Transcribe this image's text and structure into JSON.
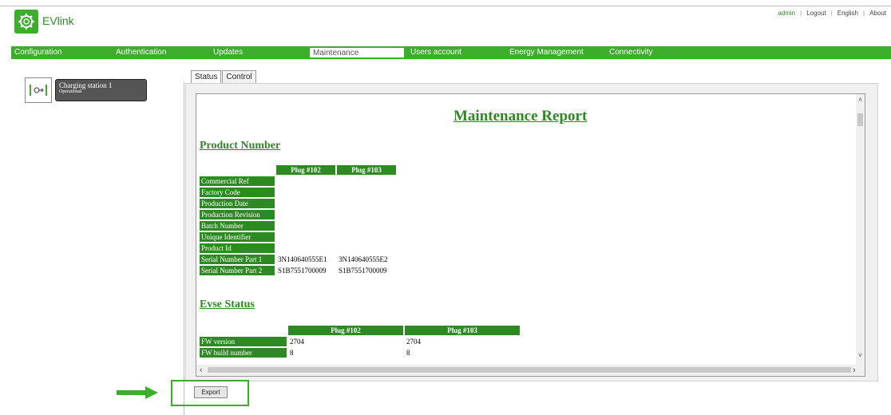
{
  "app": {
    "brand": "EVlink"
  },
  "toplinks": {
    "admin": "admin",
    "logout": "Logout",
    "language": "English",
    "about": "About",
    "separator": "|"
  },
  "nav": {
    "tabs": [
      {
        "label": "Configuration"
      },
      {
        "label": "Authentication"
      },
      {
        "label": "Updates"
      },
      {
        "label": "Maintenance",
        "active": true
      },
      {
        "label": "Users account"
      },
      {
        "label": "Energy Management"
      },
      {
        "label": "Connectivity"
      }
    ]
  },
  "station": {
    "name": "Charging station 1",
    "status": "Operational"
  },
  "subtabs": {
    "status": "Status",
    "control": "Control",
    "active": "Status"
  },
  "report": {
    "title": "Maintenance Report",
    "product_section": {
      "title": "Product Number",
      "headers": [
        "Plug #102",
        "Plug #103"
      ],
      "rows": [
        {
          "label": "Commercial Ref",
          "v1": "",
          "v2": ""
        },
        {
          "label": "Factory Code",
          "v1": "",
          "v2": ""
        },
        {
          "label": "Production Date",
          "v1": "",
          "v2": ""
        },
        {
          "label": "Production Revision",
          "v1": "",
          "v2": ""
        },
        {
          "label": "Batch Number",
          "v1": "",
          "v2": ""
        },
        {
          "label": "Unique Identifier",
          "v1": "",
          "v2": ""
        },
        {
          "label": "Product Id",
          "v1": "",
          "v2": ""
        },
        {
          "label": "Serial Number Part 1",
          "v1": "3N140640555E1",
          "v2": "3N140640555E2"
        },
        {
          "label": "Serial Number Part 2",
          "v1": "S1B7551700009",
          "v2": "S1B7551700009"
        }
      ]
    },
    "evse_section": {
      "title": "Evse Status",
      "headers": [
        "Plug #102",
        "Plug #103"
      ],
      "rows": [
        {
          "label": "FW version",
          "v1": "2704",
          "v2": "2704"
        },
        {
          "label": "FW build number",
          "v1": "8",
          "v2": "8"
        }
      ]
    }
  },
  "actions": {
    "export_label": "Export"
  },
  "colors": {
    "accent": "#3dae2b",
    "header_green": "#2d8a23",
    "station_dark": "#555555"
  },
  "icons": {
    "logo": "gear-plug-icon",
    "station": "plug-icon",
    "pointer": "right-arrow-icon"
  }
}
